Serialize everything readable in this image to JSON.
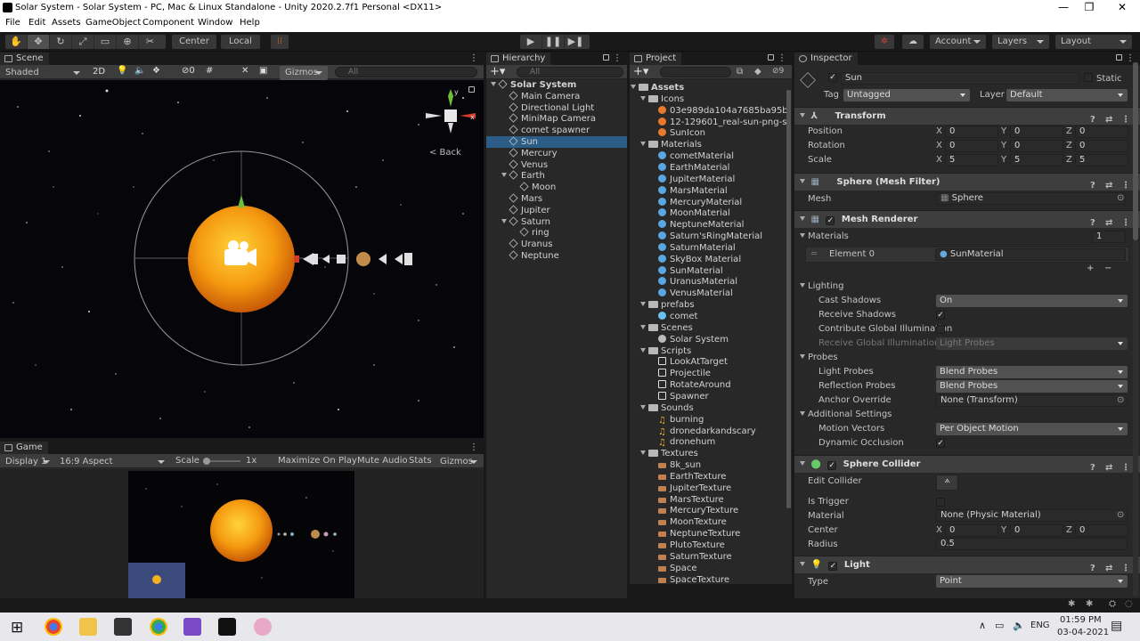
{
  "window": {
    "title": "Solar System - Solar System - PC, Mac & Linux Standalone - Unity 2020.2.7f1 Personal <DX11>"
  },
  "menu": [
    "File",
    "Edit",
    "Assets",
    "GameObject",
    "Component",
    "Window",
    "Help"
  ],
  "toolbar": {
    "pivot_center": "Center",
    "pivot_local": "Local",
    "account": "Account",
    "layers": "Layers",
    "layout": "Layout"
  },
  "scene": {
    "tab": "Scene",
    "shading": "Shaded",
    "mode_2d": "2D",
    "gizmos": "Gizmos",
    "search_placeholder": "All",
    "back_label": "< Back"
  },
  "game": {
    "tab": "Game",
    "display": "Display 1",
    "aspect": "16:9 Aspect",
    "scale_label": "Scale",
    "scale_value": "1x",
    "maximize": "Maximize On Play",
    "mute": "Mute Audio",
    "stats": "Stats",
    "gizmos": "Gizmos"
  },
  "hierarchy": {
    "tab": "Hierarchy",
    "search_placeholder": "All",
    "items": [
      {
        "label": "Solar System",
        "depth": 0,
        "expanded": true,
        "root": true
      },
      {
        "label": "Main Camera",
        "depth": 1
      },
      {
        "label": "Directional Light",
        "depth": 1
      },
      {
        "label": "MiniMap Camera",
        "depth": 1
      },
      {
        "label": "comet spawner",
        "depth": 1
      },
      {
        "label": "Sun",
        "depth": 1,
        "selected": true
      },
      {
        "label": "Mercury",
        "depth": 1
      },
      {
        "label": "Venus",
        "depth": 1
      },
      {
        "label": "Earth",
        "depth": 1,
        "expanded": true
      },
      {
        "label": "Moon",
        "depth": 2
      },
      {
        "label": "Mars",
        "depth": 1
      },
      {
        "label": "Jupiter",
        "depth": 1
      },
      {
        "label": "Saturn",
        "depth": 1,
        "expanded": true
      },
      {
        "label": "ring",
        "depth": 2
      },
      {
        "label": "Uranus",
        "depth": 1
      },
      {
        "label": "Neptune",
        "depth": 1
      }
    ]
  },
  "project": {
    "tab": "Project",
    "badge": "9",
    "items": [
      {
        "label": "Assets",
        "depth": 0,
        "type": "folder",
        "expanded": true
      },
      {
        "label": "Icons",
        "depth": 1,
        "type": "folder",
        "expanded": true
      },
      {
        "label": "03e989da104a7685ba95b0",
        "depth": 2,
        "type": "image"
      },
      {
        "label": "12-129601_real-sun-png-su",
        "depth": 2,
        "type": "image"
      },
      {
        "label": "SunIcon",
        "depth": 2,
        "type": "image"
      },
      {
        "label": "Materials",
        "depth": 1,
        "type": "folder",
        "expanded": true
      },
      {
        "label": "cometMaterial",
        "depth": 2,
        "type": "material"
      },
      {
        "label": "EarthMaterial",
        "depth": 2,
        "type": "material"
      },
      {
        "label": "JupiterMaterial",
        "depth": 2,
        "type": "material"
      },
      {
        "label": "MarsMaterial",
        "depth": 2,
        "type": "material"
      },
      {
        "label": "MercuryMaterial",
        "depth": 2,
        "type": "material"
      },
      {
        "label": "MoonMaterial",
        "depth": 2,
        "type": "material"
      },
      {
        "label": "NeptuneMaterial",
        "depth": 2,
        "type": "material"
      },
      {
        "label": "Saturn'sRingMaterial",
        "depth": 2,
        "type": "material"
      },
      {
        "label": "SaturnMaterial",
        "depth": 2,
        "type": "material"
      },
      {
        "label": "SkyBox Material",
        "depth": 2,
        "type": "material"
      },
      {
        "label": "SunMaterial",
        "depth": 2,
        "type": "material"
      },
      {
        "label": "UranusMaterial",
        "depth": 2,
        "type": "material"
      },
      {
        "label": "VenusMaterial",
        "depth": 2,
        "type": "material"
      },
      {
        "label": "prefabs",
        "depth": 1,
        "type": "folder",
        "expanded": true
      },
      {
        "label": "comet",
        "depth": 2,
        "type": "prefab"
      },
      {
        "label": "Scenes",
        "depth": 1,
        "type": "folder",
        "expanded": true
      },
      {
        "label": "Solar System",
        "depth": 2,
        "type": "scene"
      },
      {
        "label": "Scripts",
        "depth": 1,
        "type": "folder",
        "expanded": true
      },
      {
        "label": "LookAtTarget",
        "depth": 2,
        "type": "script"
      },
      {
        "label": "Projectile",
        "depth": 2,
        "type": "script"
      },
      {
        "label": "RotateAround",
        "depth": 2,
        "type": "script"
      },
      {
        "label": "Spawner",
        "depth": 2,
        "type": "script"
      },
      {
        "label": "Sounds",
        "depth": 1,
        "type": "folder",
        "expanded": true
      },
      {
        "label": "burning",
        "depth": 2,
        "type": "audio"
      },
      {
        "label": "dronedarkandscary",
        "depth": 2,
        "type": "audio"
      },
      {
        "label": "dronehum",
        "depth": 2,
        "type": "audio"
      },
      {
        "label": "Textures",
        "depth": 1,
        "type": "folder",
        "expanded": true
      },
      {
        "label": "8k_sun",
        "depth": 2,
        "type": "texture"
      },
      {
        "label": "EarthTexture",
        "depth": 2,
        "type": "texture"
      },
      {
        "label": "JupiterTexture",
        "depth": 2,
        "type": "texture"
      },
      {
        "label": "MarsTexture",
        "depth": 2,
        "type": "texture"
      },
      {
        "label": "MercuryTexture",
        "depth": 2,
        "type": "texture"
      },
      {
        "label": "MoonTexture",
        "depth": 2,
        "type": "texture"
      },
      {
        "label": "NeptuneTexture",
        "depth": 2,
        "type": "texture"
      },
      {
        "label": "PlutoTexture",
        "depth": 2,
        "type": "texture"
      },
      {
        "label": "SaturnTexture",
        "depth": 2,
        "type": "texture"
      },
      {
        "label": "Space",
        "depth": 2,
        "type": "texture"
      },
      {
        "label": "SpaceTexture",
        "depth": 2,
        "type": "texture"
      }
    ]
  },
  "inspector": {
    "tab": "Inspector",
    "name": "Sun",
    "static": "Static",
    "tag_label": "Tag",
    "tag": "Untagged",
    "layer_label": "Layer",
    "layer": "Default",
    "transform": {
      "title": "Transform",
      "position_label": "Position",
      "rotation_label": "Rotation",
      "scale_label": "Scale",
      "position": [
        "0",
        "0",
        "0"
      ],
      "rotation": [
        "0",
        "0",
        "0"
      ],
      "scale": [
        "5",
        "5",
        "5"
      ]
    },
    "mesh_filter": {
      "title": "Sphere (Mesh Filter)",
      "mesh_label": "Mesh",
      "mesh": "Sphere"
    },
    "mesh_renderer": {
      "title": "Mesh Renderer",
      "materials_label": "Materials",
      "materials_count": "1",
      "element0_label": "Element 0",
      "element0": "SunMaterial",
      "lighting_label": "Lighting",
      "cast_shadows_label": "Cast Shadows",
      "cast_shadows": "On",
      "receive_shadows_label": "Receive Shadows",
      "contribute_gi_label": "Contribute Global Illumination",
      "receive_gi_label": "Receive Global Illumination",
      "receive_gi": "Light Probes",
      "probes_label": "Probes",
      "light_probes_label": "Light Probes",
      "light_probes": "Blend Probes",
      "reflection_probes_label": "Reflection Probes",
      "reflection_probes": "Blend Probes",
      "anchor_label": "Anchor Override",
      "anchor": "None (Transform)",
      "additional_label": "Additional Settings",
      "motion_label": "Motion Vectors",
      "motion": "Per Object Motion",
      "dynamic_occlusion_label": "Dynamic Occlusion"
    },
    "sphere_collider": {
      "title": "Sphere Collider",
      "edit_label": "Edit Collider",
      "trigger_label": "Is Trigger",
      "material_label": "Material",
      "material": "None (Physic Material)",
      "center_label": "Center",
      "center": [
        "0",
        "0",
        "0"
      ],
      "radius_label": "Radius",
      "radius": "0.5"
    },
    "light": {
      "title": "Light",
      "type_label": "Type",
      "type": "Point"
    }
  },
  "axes": [
    "X",
    "Y",
    "Z"
  ],
  "taskbar": {
    "lang": "ENG",
    "time": "01:59 PM",
    "date": "03-04-2021"
  },
  "colors": {
    "selection": "#2c5d87",
    "panel": "#282828",
    "sun": "#f5a623"
  }
}
